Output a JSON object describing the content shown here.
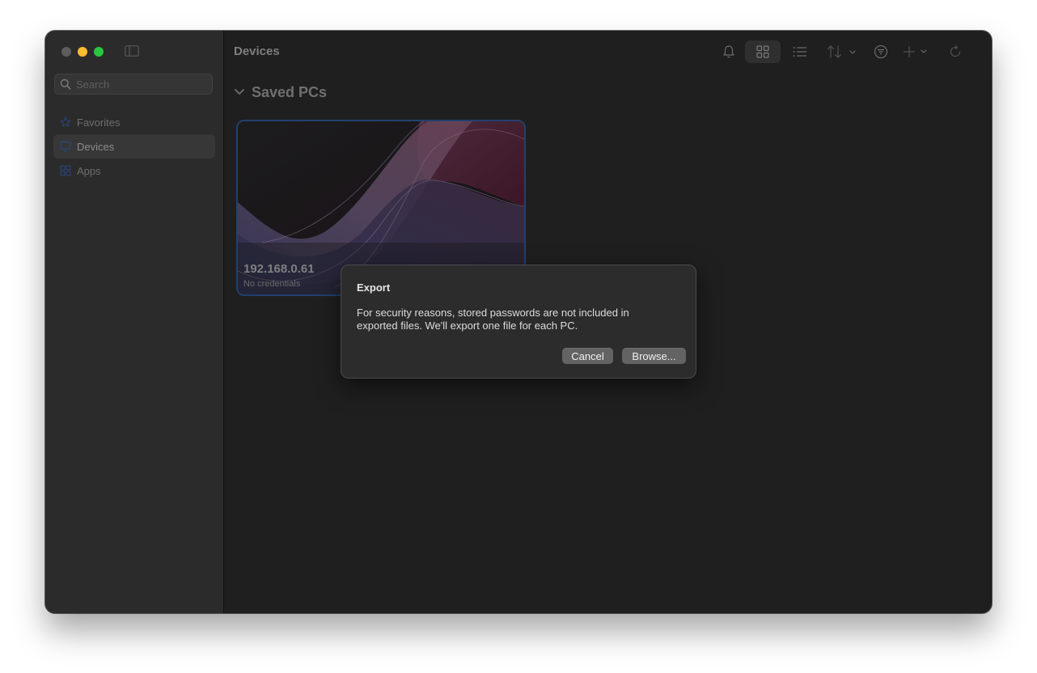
{
  "window": {
    "title": "Devices"
  },
  "sidebar": {
    "search_placeholder": "Search",
    "items": [
      {
        "label": "Favorites",
        "icon": "star-icon",
        "active": false
      },
      {
        "label": "Devices",
        "icon": "monitor-icon",
        "active": true
      },
      {
        "label": "Apps",
        "icon": "apps-grid-icon",
        "active": false
      }
    ]
  },
  "toolbar": {
    "icons": [
      "bell-icon",
      "grid-view-icon",
      "list-view-icon",
      "sort-icon",
      "filter-icon",
      "add-icon",
      "refresh-icon"
    ]
  },
  "section": {
    "title": "Saved PCs",
    "expanded": true
  },
  "cards": [
    {
      "title": "192.168.0.61",
      "subtitle": "No credentials"
    }
  ],
  "dialog": {
    "title": "Export",
    "message": "For security reasons, stored passwords are not included in exported files. We'll export one file for each PC.",
    "cancel_label": "Cancel",
    "browse_label": "Browse..."
  },
  "colors": {
    "window_bg": "#1f1f1f",
    "sidebar_bg": "#2b2b2b",
    "card_border": "#22406e",
    "dialog_bg": "#2c2c2c",
    "button_bg": "#636363",
    "traffic_red_dimmed": "#5d5d5d",
    "traffic_yellow": "#febc2e",
    "traffic_green": "#28c840"
  }
}
